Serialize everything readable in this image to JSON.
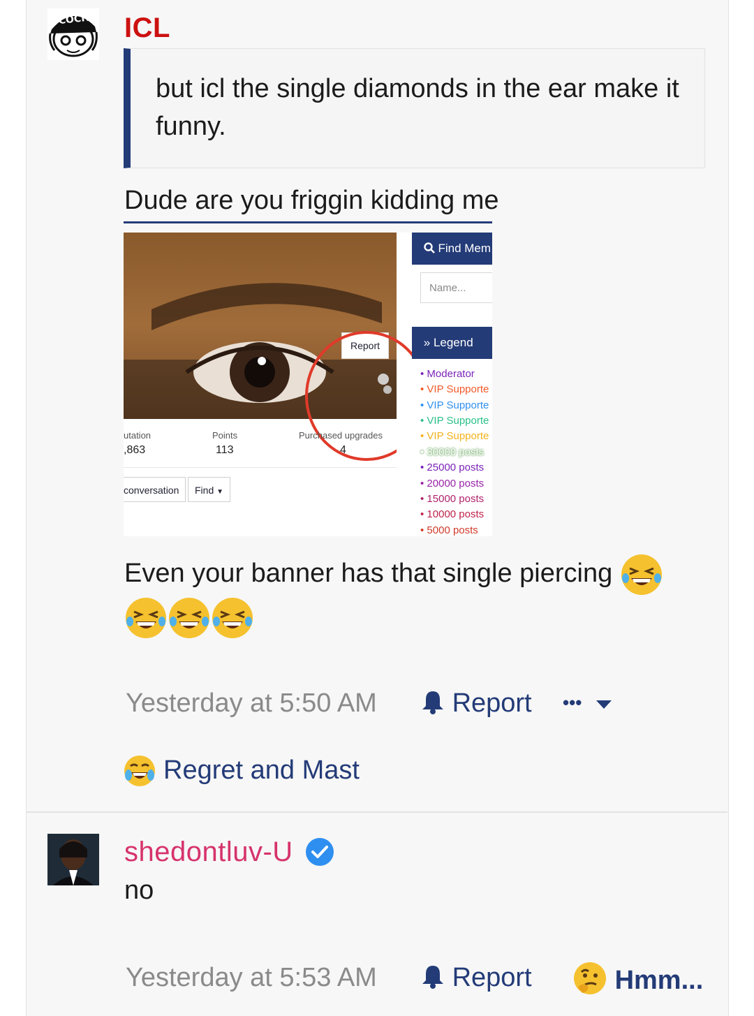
{
  "post1": {
    "username": "ICL",
    "quote": "but icl the single diamonds in the ear make it funny.",
    "headline": "Dude are you friggin kidding me",
    "embedded_screenshot": {
      "report_label": "Report",
      "stats": [
        {
          "label": "utation",
          "value": ",863"
        },
        {
          "label": "Points",
          "value": "113"
        },
        {
          "label": "Purchased upgrades",
          "value": "4"
        }
      ],
      "buttons": [
        "conversation",
        "Find"
      ],
      "find_members_label": "Find Mem",
      "name_placeholder": "Name...",
      "legend_title": "Legend",
      "legend_items": [
        {
          "label": "Moderator",
          "color": "#7a22b8"
        },
        {
          "label": "VIP Supporte",
          "color": "#f05a28"
        },
        {
          "label": "VIP Supporte",
          "color": "#2f8ff0"
        },
        {
          "label": "VIP Supporte",
          "color": "#29c08a"
        },
        {
          "label": "VIP Supporte",
          "color": "#f2b21c"
        },
        {
          "label": "30000 posts",
          "color": "#b8d8b0"
        },
        {
          "label": "25000 posts",
          "color": "#7a22b8"
        },
        {
          "label": "20000 posts",
          "color": "#9a22a8"
        },
        {
          "label": "15000 posts",
          "color": "#b0226c"
        },
        {
          "label": "10000 posts",
          "color": "#c0224c"
        },
        {
          "label": "5000 posts",
          "color": "#d03a2a"
        }
      ]
    },
    "sentence": "Even your banner has that single piercing",
    "timestamp": "Yesterday at 5:50 AM",
    "report_label": "Report",
    "more_label": "•••",
    "reaction_label": "Regret and Mast"
  },
  "post2": {
    "username": "shedontluv-U",
    "text": "no",
    "timestamp": "Yesterday at 5:53 AM",
    "report_label": "Report",
    "reaction_label": "Hmm..."
  },
  "colors": {
    "accent": "#233b77",
    "username1": "#cc1111",
    "username2": "#d6336c",
    "meta_gray": "#8a8a8a",
    "verified": "#2f8ff0"
  }
}
